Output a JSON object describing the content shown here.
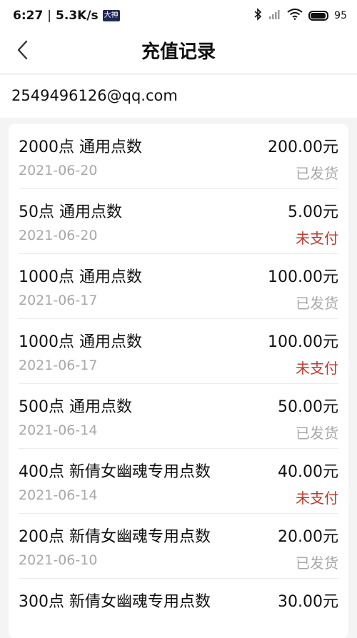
{
  "status_bar": {
    "time": "6:27",
    "speed": "5.3K/s",
    "app_badge": "大神",
    "battery_text": "95",
    "battery_level": 0.95
  },
  "header": {
    "title": "充值记录"
  },
  "account": {
    "email": "2549496126@qq.com"
  },
  "colors": {
    "status_shipped": "#a8a8a8",
    "status_unpaid": "#c0392b"
  },
  "records": [
    {
      "name": "2000点 通用点数",
      "amount": "200.00元",
      "date": "2021-06-20",
      "status": "已发货",
      "status_type": "shipped"
    },
    {
      "name": "50点 通用点数",
      "amount": "5.00元",
      "date": "2021-06-20",
      "status": "未支付",
      "status_type": "unpaid"
    },
    {
      "name": "1000点 通用点数",
      "amount": "100.00元",
      "date": "2021-06-17",
      "status": "已发货",
      "status_type": "shipped"
    },
    {
      "name": "1000点 通用点数",
      "amount": "100.00元",
      "date": "2021-06-17",
      "status": "未支付",
      "status_type": "unpaid"
    },
    {
      "name": "500点 通用点数",
      "amount": "50.00元",
      "date": "2021-06-14",
      "status": "已发货",
      "status_type": "shipped"
    },
    {
      "name": "400点 新倩女幽魂专用点数",
      "amount": "40.00元",
      "date": "2021-06-14",
      "status": "未支付",
      "status_type": "unpaid"
    },
    {
      "name": "200点 新倩女幽魂专用点数",
      "amount": "20.00元",
      "date": "2021-06-10",
      "status": "已发货",
      "status_type": "shipped"
    },
    {
      "name": "300点 新倩女幽魂专用点数",
      "amount": "30.00元",
      "date": "",
      "status": "",
      "status_type": ""
    }
  ]
}
